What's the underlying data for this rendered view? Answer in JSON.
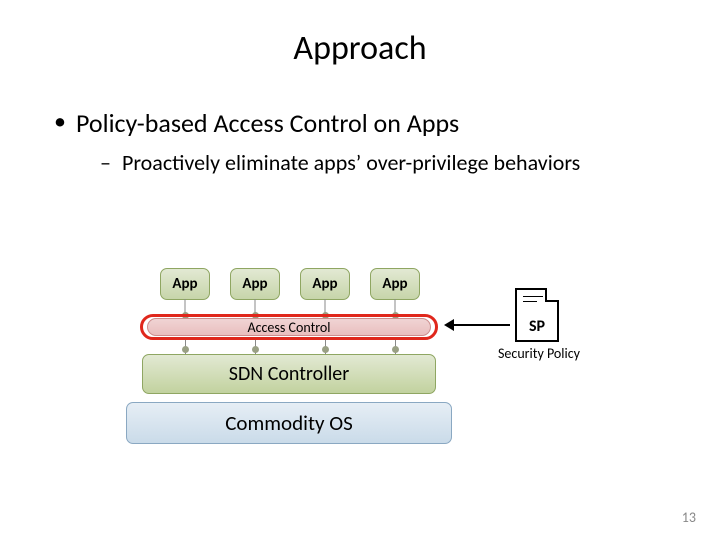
{
  "title": "Approach",
  "bullets": {
    "b1": "Policy-based Access Control on Apps",
    "b2": "Proactively eliminate apps’ over-privilege behaviors"
  },
  "diagram": {
    "apps": [
      "App",
      "App",
      "App",
      "App"
    ],
    "access_control": "Access Control",
    "sdn": "SDN Controller",
    "os": "Commodity OS",
    "sp_label": "SP",
    "sp_caption": "Security Policy"
  },
  "page_number": "13"
}
